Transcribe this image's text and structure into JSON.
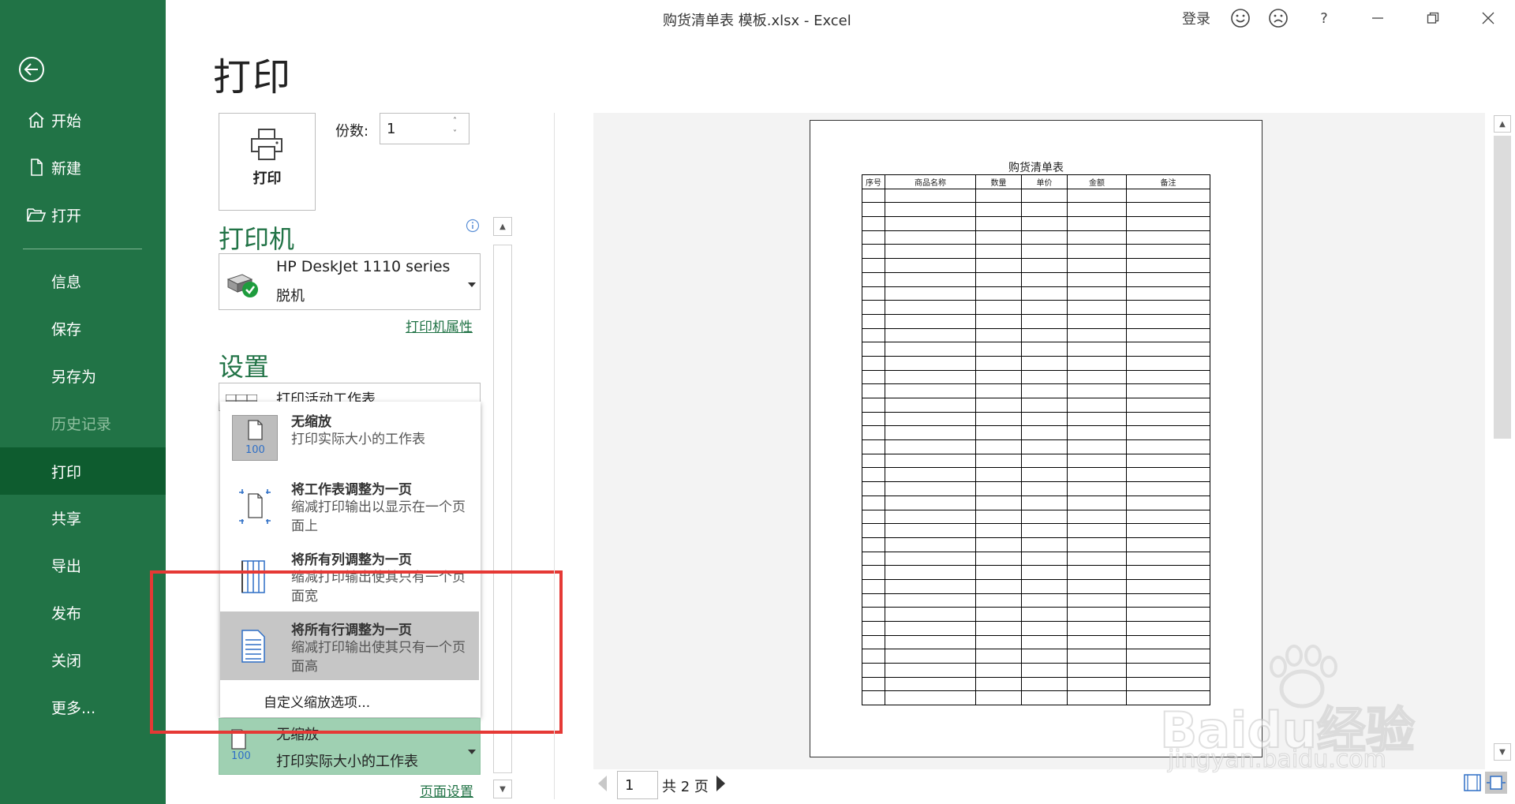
{
  "window": {
    "title": "购货清单表 模板.xlsx  -  Excel",
    "signin": "登录",
    "help": "?"
  },
  "sidebar": {
    "items": [
      {
        "label": "开始"
      },
      {
        "label": "新建"
      },
      {
        "label": "打开"
      },
      {
        "label": "信息"
      },
      {
        "label": "保存"
      },
      {
        "label": "另存为"
      },
      {
        "label": "历史记录"
      },
      {
        "label": "打印"
      },
      {
        "label": "共享"
      },
      {
        "label": "导出"
      },
      {
        "label": "发布"
      },
      {
        "label": "关闭"
      },
      {
        "label": "更多..."
      }
    ]
  },
  "print": {
    "heading": "打印",
    "button_label": "打印",
    "copies_label": "份数:",
    "copies_value": "1"
  },
  "printer": {
    "heading": "打印机",
    "name": "HP DeskJet 1110 series",
    "status": "脱机",
    "properties_link": "打印机属性"
  },
  "settings": {
    "heading": "设置",
    "active_sheet": "打印活动工作表",
    "scaling_options": [
      {
        "title": "无缩放",
        "desc": "打印实际大小的工作表"
      },
      {
        "title": "将工作表调整为一页",
        "desc": "缩减打印输出以显示在一个页面上"
      },
      {
        "title": "将所有列调整为一页",
        "desc": "缩减打印输出使其只有一个页面宽"
      },
      {
        "title": "将所有行调整为一页",
        "desc": "缩减打印输出使其只有一个页面高"
      }
    ],
    "custom_scaling": "自定义缩放选项...",
    "current_title": "无缩放",
    "current_desc": "打印实际大小的工作表",
    "badge": "100",
    "page_setup_link": "页面设置"
  },
  "preview": {
    "sheet_title": "购货清单表",
    "columns": [
      "序号",
      "商品名称",
      "数量",
      "单价",
      "金额",
      "备注"
    ],
    "current_page": "1",
    "page_total": "共 2 页"
  },
  "watermark": {
    "brand": "Baidu经验",
    "url": "jingyan.baidu.com"
  },
  "colors": {
    "accent": "#217346",
    "selected": "#c6c6c6",
    "highlight_box": "#e53935"
  }
}
